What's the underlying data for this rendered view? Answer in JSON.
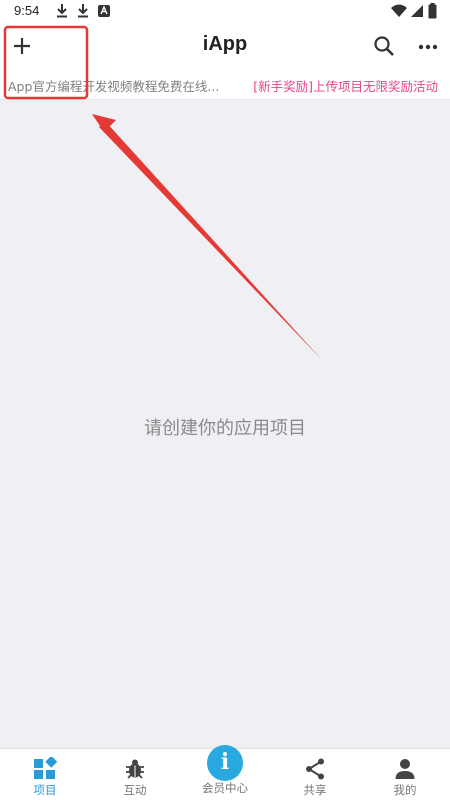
{
  "status_bar": {
    "time": "9:54",
    "icons": [
      "download-icon",
      "download-icon",
      "store-icon",
      "wifi-icon",
      "signal-icon",
      "battery-icon"
    ]
  },
  "app_bar": {
    "title": "iApp",
    "add_icon": "plus-icon",
    "search_icon": "search-icon",
    "more_icon": "more-icon"
  },
  "marquee": {
    "left_text": "App官方编程开发视频教程免费在线...",
    "right_text": "[新手奖励]上传项目无限奖励活动",
    "right_color": "#e8438a"
  },
  "main": {
    "empty_text": "请创建你的应用项目"
  },
  "annotation": {
    "color": "#e53935"
  },
  "bottom_nav": {
    "items": [
      {
        "label": "项目",
        "icon": "grid-icon",
        "active": true
      },
      {
        "label": "互动",
        "icon": "bug-icon",
        "active": false
      },
      {
        "label": "会员中心",
        "icon": "info-badge-icon",
        "badge_letter": "i",
        "active": false
      },
      {
        "label": "共享",
        "icon": "share-icon",
        "active": false
      },
      {
        "label": "我的",
        "icon": "person-icon",
        "active": false
      }
    ],
    "active_color": "#2a9bd6"
  }
}
